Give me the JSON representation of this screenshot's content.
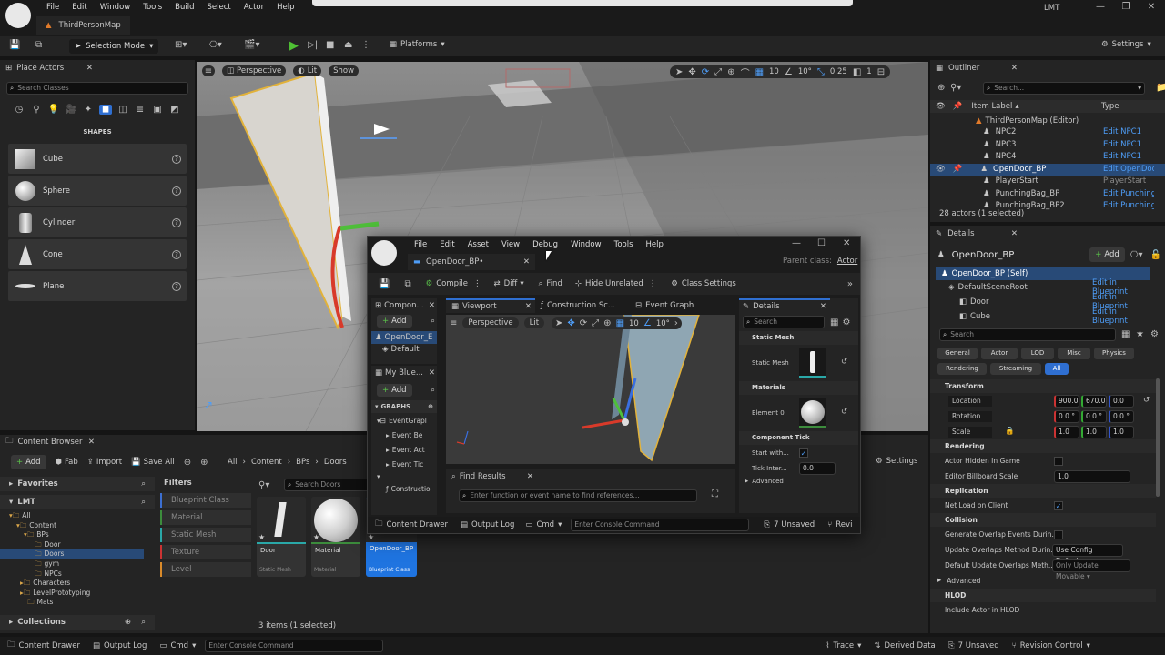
{
  "menubar": {
    "items": [
      "File",
      "Edit",
      "Window",
      "Tools",
      "Build",
      "Select",
      "Actor",
      "Help"
    ],
    "project_tab": "ThirdPersonMap",
    "user": "LMT"
  },
  "toolbar": {
    "selection_mode": "Selection Mode",
    "platforms": "Platforms",
    "settings": "Settings"
  },
  "place_actors": {
    "title": "Place Actors",
    "search_placeholder": "Search Classes",
    "category": "SHAPES",
    "items": [
      "Cube",
      "Sphere",
      "Cylinder",
      "Cone",
      "Plane"
    ]
  },
  "viewport": {
    "perspective": "Perspective",
    "lit": "Lit",
    "show": "Show",
    "grid": "10",
    "angle": "10°",
    "scale": "0.25",
    "cams": "1"
  },
  "outliner": {
    "title": "Outliner",
    "search_placeholder": "Search...",
    "col_label": "Item Label",
    "col_type": "Type",
    "root": "ThirdPersonMap (Editor)",
    "rows": [
      {
        "label": "NPC2",
        "type": "Edit NPC1"
      },
      {
        "label": "NPC3",
        "type": "Edit NPC1"
      },
      {
        "label": "NPC4",
        "type": "Edit NPC1"
      },
      {
        "label": "OpenDoor_BP",
        "type": "Edit OpenDoor"
      },
      {
        "label": "PlayerStart",
        "type": "PlayerStart"
      },
      {
        "label": "PunchingBag_BP",
        "type": "Edit Punchingl"
      },
      {
        "label": "PunchingBag_BP2",
        "type": "Edit Punchingl"
      }
    ],
    "status": "28 actors (1 selected)"
  },
  "details": {
    "title": "Details",
    "object": "OpenDoor_BP",
    "add": "Add",
    "self": "OpenDoor_BP (Self)",
    "components": [
      {
        "name": "DefaultSceneRoot",
        "link": "Edit in Blueprint"
      },
      {
        "name": "Door",
        "link": "Edit in Blueprint"
      },
      {
        "name": "Cube",
        "link": "Edit in Blueprint"
      }
    ],
    "search_placeholder": "Search",
    "filters": [
      "General",
      "Actor",
      "LOD",
      "Misc",
      "Physics",
      "Rendering",
      "Streaming",
      "All"
    ],
    "transform": "Transform",
    "location": "Location",
    "rotation": "Rotation",
    "scale": "Scale",
    "loc_vals": [
      "900.0",
      "670.0",
      "0.0"
    ],
    "rot_vals": [
      "0.0 °",
      "0.0 °",
      "0.0 °"
    ],
    "scale_vals": [
      "1.0",
      "1.0",
      "1.0"
    ],
    "rendering": "Rendering",
    "actor_hidden": "Actor Hidden In Game",
    "billboard": "Editor Billboard Scale",
    "billboard_val": "1.0",
    "replication": "Replication",
    "net_load": "Net Load on Client",
    "collision": "Collision",
    "gen_overlap": "Generate Overlap Events Durin...",
    "update_overlap": "Update Overlaps Method Durin...",
    "update_overlap_val": "Use Config Default",
    "default_update": "Default Update Overlaps Meth...",
    "default_update_val": "Only Update Movable",
    "advanced": "Advanced",
    "hlod": "HLOD",
    "include_hlod": "Include Actor in HLOD"
  },
  "content_browser": {
    "title": "Content Browser",
    "add": "Add",
    "fab": "Fab",
    "import": "Import",
    "save_all": "Save All",
    "path": [
      "All",
      "Content",
      "BPs",
      "Doors"
    ],
    "settings": "Settings",
    "favorites": "Favorites",
    "project": "LMT",
    "tree": [
      "All",
      "Content",
      "BPs",
      "Door",
      "Doors",
      "gym",
      "NPCs",
      "Characters",
      "LevelPrototyping",
      "Mats"
    ],
    "collections": "Collections",
    "filters_title": "Filters",
    "search_placeholder": "Search Doors",
    "filters": [
      "Blueprint Class",
      "Material",
      "Static Mesh",
      "Texture",
      "Level"
    ],
    "assets": [
      {
        "name": "Door",
        "type": "Static Mesh"
      },
      {
        "name": "Material",
        "type": "Material"
      },
      {
        "name": "OpenDoor_BP",
        "type": "Blueprint Class"
      }
    ],
    "status": "3 items (1 selected)"
  },
  "bottom_bar": {
    "drawer": "Content Drawer",
    "output": "Output Log",
    "cmd": "Cmd",
    "console_placeholder": "Enter Console Command",
    "trace": "Trace",
    "derived": "Derived Data",
    "unsaved": "7 Unsaved",
    "revision": "Revision Control"
  },
  "bp_editor": {
    "menu": [
      "File",
      "Edit",
      "Asset",
      "View",
      "Debug",
      "Window",
      "Tools",
      "Help"
    ],
    "tab": "OpenDoor_BP•",
    "parent_label": "Parent class:",
    "parent_value": "Actor",
    "compile": "Compile",
    "diff": "Diff",
    "find": "Find",
    "hide_unrelated": "Hide Unrelated",
    "class_settings": "Class Settings",
    "components_tab": "Compon...",
    "comp_root": "OpenDoor_E",
    "comp_child": "Default",
    "my_bp_tab": "My Blue...",
    "graphs": "GRAPHS",
    "event_graph_item": "EventGrapl",
    "events": [
      "Event Be",
      "Event Act",
      "Event Tic"
    ],
    "construction": "Constructio",
    "viewport_tab": "Viewport",
    "construction_tab": "Construction Sc...",
    "event_graph_tab": "Event Graph",
    "perspective": "Perspective",
    "lit": "Lit",
    "grid": "10",
    "angle": "10°",
    "find_results": "Find Results",
    "find_placeholder": "Enter function or event name to find references...",
    "details_tab": "Details",
    "search_placeholder": "Search",
    "static_mesh_sec": "Static Mesh",
    "static_mesh_label": "Static Mesh",
    "materials_sec": "Materials",
    "element0": "Element 0",
    "tick_sec": "Component Tick",
    "start_with": "Start with...",
    "tick_interval": "Tick Inter...",
    "tick_val": "0.0",
    "advanced": "Advanced",
    "bottom": {
      "drawer": "Content Drawer",
      "output": "Output Log",
      "cmd": "Cmd",
      "console_placeholder": "Enter Console Command",
      "unsaved": "7 Unsaved",
      "revision": "Revi"
    }
  }
}
